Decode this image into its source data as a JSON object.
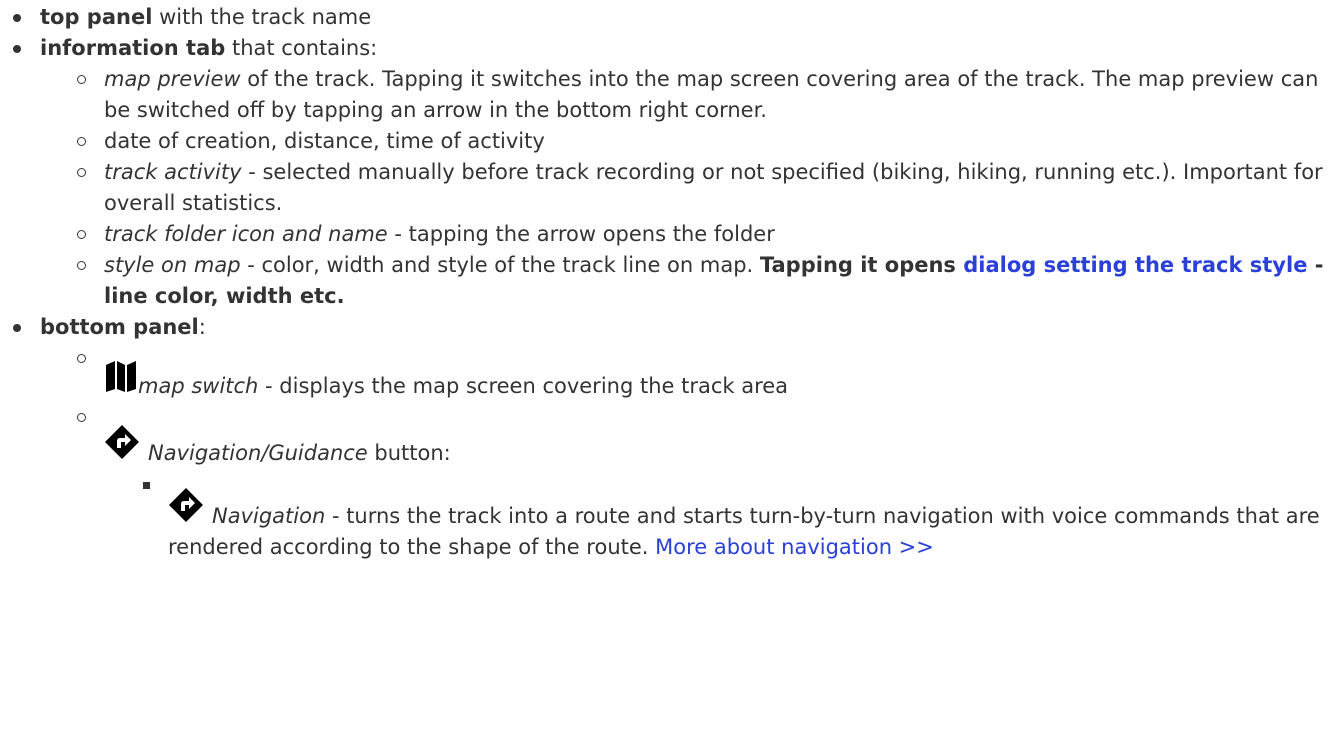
{
  "items": {
    "top_panel": {
      "bold": "top panel",
      "rest": " with the track name"
    },
    "info_tab": {
      "bold": "information tab",
      "rest": " that contains:",
      "sub": {
        "map_preview": {
          "italic": "map preview",
          "rest": " of the track. Tapping it switches into the map screen covering area of the track. The map preview can be switched off by tapping an arrow in the bottom right corner."
        },
        "date_line": {
          "text": "date of creation, distance, time of activity"
        },
        "activity": {
          "italic": "track activity",
          "rest": " - selected manually before track recording or not specified (biking, hiking, running etc.). Important for overall statistics."
        },
        "folder": {
          "italic": "track folder icon and name",
          "rest": " - tapping the arrow opens the folder"
        },
        "style": {
          "italic": "style on map",
          "rest": " - color, width and style of the track line on map. ",
          "bold_a": "Tapping it opens ",
          "link": "dialog setting the track style",
          "bold_b": " - line color, width etc."
        }
      }
    },
    "bottom_panel": {
      "bold": "bottom panel",
      "rest": ":",
      "sub": {
        "map_switch": {
          "icon": "map-icon",
          "italic": "map switch",
          "rest": " - displays the map screen covering the track area"
        },
        "nav_button": {
          "icon": "navigation-diamond-icon",
          "italic": "Navigation/Guidance",
          "rest": " button:",
          "sub": {
            "navigation": {
              "icon": "navigation-diamond-icon",
              "italic": "Navigation",
              "rest": " - turns the track into a route and starts turn-by-turn navigation with voice commands that are rendered according to the shape of the route. ",
              "link": "More about navigation >>"
            }
          }
        }
      }
    }
  }
}
